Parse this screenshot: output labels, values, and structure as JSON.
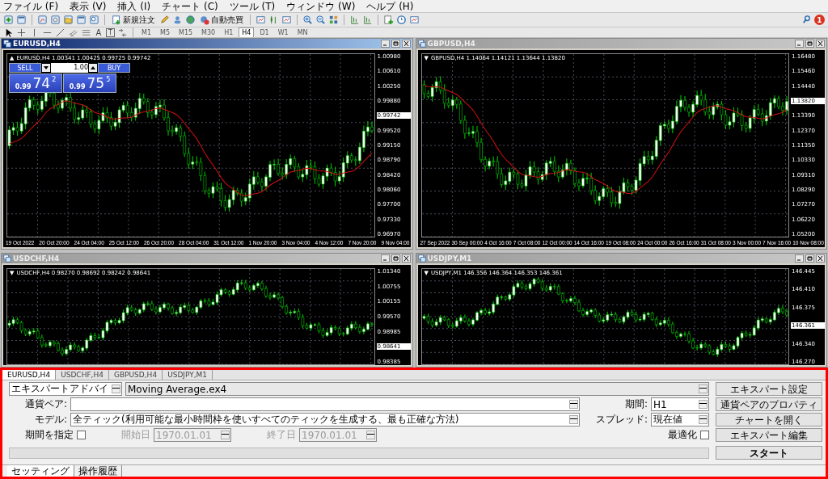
{
  "menu": [
    "ファイル (F)",
    "表示 (V)",
    "挿入 (I)",
    "チャート (C)",
    "ツール (T)",
    "ウィンドウ (W)",
    "ヘルプ (H)"
  ],
  "toolbar": {
    "new_order": "新規注文",
    "auto_trading": "自動売買",
    "notification_count": "1"
  },
  "drawing_toolbar": {
    "text_tool": "A",
    "label_tool": "T"
  },
  "timeframes": [
    {
      "label": "M1",
      "selected": false
    },
    {
      "label": "M5",
      "selected": false
    },
    {
      "label": "M15",
      "selected": false
    },
    {
      "label": "M30",
      "selected": false
    },
    {
      "label": "H1",
      "selected": false
    },
    {
      "label": "H4",
      "selected": true
    },
    {
      "label": "D1",
      "selected": false
    },
    {
      "label": "W1",
      "selected": false
    },
    {
      "label": "MN",
      "selected": false
    }
  ],
  "charts": [
    {
      "title": "EURUSD,H4",
      "active": true,
      "direction": "▲",
      "header": "EURUSD,H4  1.00341 1.00425 0.99725 0.99742",
      "moving_average": true,
      "price_labels": [
        {
          "text": "1.00980",
          "current": false
        },
        {
          "text": "1.00610",
          "current": false
        },
        {
          "text": "1.00250",
          "current": false
        },
        {
          "text": "0.99880",
          "current": false
        },
        {
          "text": "0.99742",
          "current": true
        },
        {
          "text": "0.99520",
          "current": false
        },
        {
          "text": "0.99150",
          "current": false
        },
        {
          "text": "0.98790",
          "current": false
        },
        {
          "text": "0.98420",
          "current": false
        },
        {
          "text": "0.98060",
          "current": false
        },
        {
          "text": "0.97700",
          "current": false
        },
        {
          "text": "0.97330",
          "current": false
        },
        {
          "text": "0.96970",
          "current": false
        }
      ],
      "time_labels": [
        "19 Oct 2022",
        "20 Oct 20:00",
        "24 Oct 04:00",
        "25 Oct 12:00",
        "26 Oct 20:00",
        "28 Oct 04:00",
        "31 Oct 12:00",
        "1 Nov 20:00",
        "3 Nov 04:00",
        "4 Nov 12:00",
        "7 Nov 20:00",
        "9 Nov 04:00"
      ],
      "trade_panel": {
        "sell": "SELL",
        "buy": "BUY",
        "volume": "1.00",
        "sell_price": {
          "prefix": "0.99",
          "big": "74",
          "pip": "2"
        },
        "buy_price": {
          "prefix": "0.99",
          "big": "75",
          "pip": "5"
        }
      }
    },
    {
      "title": "GBPUSD,H4",
      "active": false,
      "direction": "▼",
      "header": "GBPUSD,H4  1.14064 1.14121 1.13644 1.13820",
      "moving_average": true,
      "price_labels": [
        {
          "text": "1.16480",
          "current": false
        },
        {
          "text": "1.15460",
          "current": false
        },
        {
          "text": "1.14440",
          "current": false
        },
        {
          "text": "1.13820",
          "current": true
        },
        {
          "text": "1.13390",
          "current": false
        },
        {
          "text": "1.12370",
          "current": false
        },
        {
          "text": "1.11350",
          "current": false
        },
        {
          "text": "1.10330",
          "current": false
        },
        {
          "text": "1.09310",
          "current": false
        },
        {
          "text": "1.08290",
          "current": false
        },
        {
          "text": "1.07270",
          "current": false
        },
        {
          "text": "1.06220",
          "current": false
        },
        {
          "text": "1.05200",
          "current": false
        }
      ],
      "time_labels": [
        "27 Sep 2022",
        "30 Sep 00:00",
        "4 Oct 16:00",
        "7 Oct 08:00",
        "12 Oct 00:00",
        "14 Oct 16:00",
        "19 Oct 08:00",
        "24 Oct 00:00",
        "26 Oct 16:00",
        "31 Oct 08:00",
        "3 Nov 00:00",
        "7 Nov 16:00",
        "10 Nov 08:00"
      ]
    },
    {
      "title": "USDCHF,H4",
      "active": false,
      "direction": "▼",
      "header": "USDCHF,H4  0.98270 0.98692 0.98242 0.98641",
      "moving_average": false,
      "price_labels": [
        {
          "text": "1.01340",
          "current": false
        },
        {
          "text": "1.00755",
          "current": false
        },
        {
          "text": "1.00155",
          "current": false
        },
        {
          "text": "0.99570",
          "current": false
        },
        {
          "text": "0.98985",
          "current": false
        },
        {
          "text": "0.98641",
          "current": true
        },
        {
          "text": "0.98385",
          "current": false
        }
      ]
    },
    {
      "title": "USDJPY,M1",
      "active": false,
      "direction": "▼",
      "header": "USDJPY,M1  146.356 146.364 146.353 146.361",
      "moving_average": false,
      "price_labels": [
        {
          "text": "146.445",
          "current": false
        },
        {
          "text": "146.410",
          "current": false
        },
        {
          "text": "146.375",
          "current": false
        },
        {
          "text": "146.361",
          "current": true
        },
        {
          "text": "146.340",
          "current": false
        },
        {
          "text": "146.270",
          "current": false
        }
      ]
    }
  ],
  "tester": {
    "tabs": [
      {
        "label": "EURUSD,H4",
        "selected": true
      },
      {
        "label": "USDCHF,H4",
        "selected": false
      },
      {
        "label": "GBPUSD,H4",
        "selected": false
      },
      {
        "label": "USDJPY,M1",
        "selected": false
      }
    ],
    "type_select": "エキスパートアドバイ",
    "expert_select": "Moving Average.ex4",
    "expert_settings_button": "エキスパート設定",
    "symbol_label": "通貨ペア:",
    "period_label": "期間:",
    "period_select": "H1",
    "symbol_properties_button": "通貨ペアのプロパティ",
    "model_label": "モデル:",
    "model_select": "全ティック(利用可能な最小時間枠を使いすべてのティックを生成する、最も正確な方法)",
    "spread_label": "スプレッド:",
    "spread_select": "現在値",
    "open_chart_button": "チャートを開く",
    "use_date_label": "期間を指定",
    "use_date": false,
    "from_label": "開始日",
    "from_date": "1970.01.01",
    "to_label": "終了日",
    "to_date": "1970.01.01",
    "dates_disabled": true,
    "optimization_label": "最適化",
    "optimization": false,
    "edit_expert_button": "エキスパート編集",
    "progress": {
      "level": 0
    },
    "start_button": "スタート",
    "bottom_tabs": [
      {
        "label": "セッティング",
        "selected": true
      },
      {
        "label": "操作履歴",
        "selected": false
      }
    ]
  }
}
